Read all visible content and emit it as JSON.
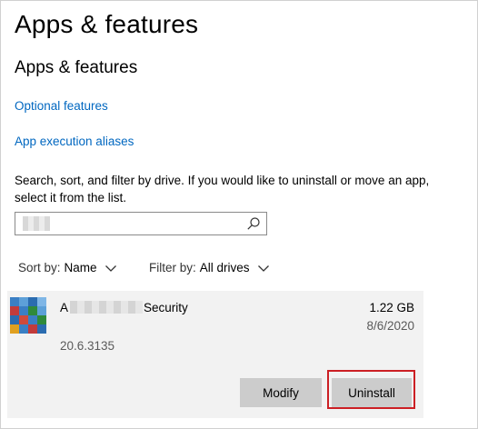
{
  "page": {
    "title": "Apps & features",
    "section_title": "Apps & features"
  },
  "links": {
    "optional_features": "Optional features",
    "execution_aliases": "App execution aliases"
  },
  "description": "Search, sort, and filter by drive. If you would like to uninstall or move an app, select it from the list.",
  "search": {
    "value": "",
    "icon": "search-icon"
  },
  "sort": {
    "label": "Sort by:",
    "value": "Name"
  },
  "filter": {
    "label": "Filter by:",
    "value": "All drives"
  },
  "app": {
    "name_prefix": "A",
    "name_suffix": "Security",
    "size": "1.22 GB",
    "date": "8/6/2020",
    "version": "20.6.3135",
    "modify_label": "Modify",
    "uninstall_label": "Uninstall"
  },
  "colors": {
    "link": "#0067c0",
    "button_bg": "#cccccc",
    "card_bg": "#f2f2f2",
    "highlight": "#cc1f24"
  }
}
